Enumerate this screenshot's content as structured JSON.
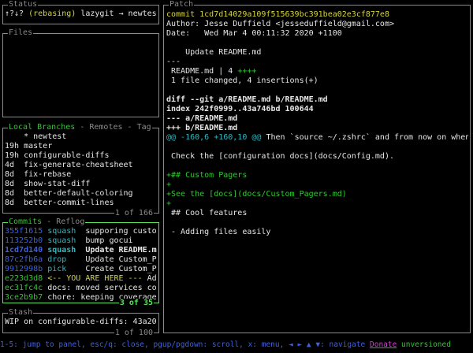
{
  "colors": {
    "blue": "#3f5fe0",
    "cyan": "#2fb8c0",
    "green": "#2ec82e",
    "yellow": "#d6d63a",
    "white": "#e6e6e6",
    "grey": "#8a8a8a",
    "magenta": "#d040d0",
    "frame_active": "#5fe35f"
  },
  "status": {
    "title": "Status",
    "line": [
      {
        "t": "↑?↓? ",
        "c": "white"
      },
      {
        "t": "(rebasing)",
        "c": "yellow"
      },
      {
        "t": " lazygit → newtes",
        "c": "white"
      }
    ]
  },
  "files": {
    "title": "Files"
  },
  "branches": {
    "tabs": [
      {
        "label": "Local Branches",
        "active": true
      },
      {
        "label": "Remotes",
        "active": false
      },
      {
        "label": "Tag",
        "active": false
      }
    ],
    "sep": " - ",
    "footer": "1 of 166",
    "items": [
      {
        "age": "",
        "name": "* newtest"
      },
      {
        "age": "19h",
        "name": "master"
      },
      {
        "age": "19h",
        "name": "configurable-diffs"
      },
      {
        "age": "4d",
        "name": "fix-generate-cheatsheet"
      },
      {
        "age": "8d",
        "name": "fix-rebase"
      },
      {
        "age": "8d",
        "name": "show-stat-diff"
      },
      {
        "age": "8d",
        "name": "better-default-coloring"
      },
      {
        "age": "8d",
        "name": "better-commit-lines"
      }
    ]
  },
  "commits": {
    "tabs": [
      {
        "label": "Commits",
        "active": true
      },
      {
        "label": "Reflog",
        "active": false
      }
    ],
    "sep": " - ",
    "footer": "3 of 35",
    "items": [
      {
        "hash": "355f1615",
        "hc": "blue",
        "action": "squash",
        "ac": "cyan",
        "msg": "supporing custo",
        "mc": "white",
        "selected": false
      },
      {
        "hash": "113252b0",
        "hc": "blue",
        "action": "squash",
        "ac": "cyan",
        "msg": "bump gocui",
        "mc": "white",
        "selected": false
      },
      {
        "hash": "1cd7d140",
        "hc": "blue",
        "action": "squash",
        "ac": "cyan",
        "msg": "Update README.m",
        "mc": "white",
        "selected": true
      },
      {
        "hash": "87c2fb6a",
        "hc": "blue",
        "action": "drop",
        "ac": "cyan",
        "msg": "Update Custom_P",
        "mc": "white",
        "selected": false
      },
      {
        "hash": "9912998b",
        "hc": "blue",
        "action": "pick",
        "ac": "cyan",
        "msg": "Create Custom_P",
        "mc": "white",
        "selected": false
      },
      {
        "hash": "e223d3d8",
        "hc": "green",
        "action": "<-- YOU ARE HERE ---",
        "ac": "yellow",
        "msg": "Ad",
        "mc": "white",
        "selected": false
      },
      {
        "hash": "ec31fc4c",
        "hc": "green",
        "action": "",
        "ac": "white",
        "msg": "docs: moved services co",
        "mc": "white",
        "selected": false
      },
      {
        "hash": "3ce2b9b7",
        "hc": "green",
        "action": "",
        "ac": "white",
        "msg": "chore: keeping coverage",
        "mc": "white",
        "selected": false
      }
    ]
  },
  "stash": {
    "title": "Stash",
    "footer": "1 of 100",
    "items": [
      "WIP on configurable-diffs: 43a20"
    ]
  },
  "patch": {
    "title": "Patch",
    "lines": [
      [
        {
          "t": "commit 1cd7d14029a109f515639bc391bea02e3cf877e8",
          "c": "yellow"
        }
      ],
      [
        {
          "t": "Author: Jesse Duffield <jesseduffield@gmail.com>",
          "c": "white"
        }
      ],
      [
        {
          "t": "Date:   Wed Mar 4 00:11:32 2020 +1100",
          "c": "white"
        }
      ],
      [],
      [
        {
          "t": "    Update README.md",
          "c": "white"
        }
      ],
      [
        {
          "t": "---",
          "c": "white"
        }
      ],
      [
        {
          "t": " README.md | 4 ",
          "c": "white"
        },
        {
          "t": "++++",
          "c": "green"
        }
      ],
      [
        {
          "t": " 1 file changed, 4 insertions(+)",
          "c": "white"
        }
      ],
      [],
      [
        {
          "t": "diff --git a/README.md b/README.md",
          "c": "white",
          "b": true
        }
      ],
      [
        {
          "t": "index 242f0999..43a746bd 100644",
          "c": "white",
          "b": true
        }
      ],
      [
        {
          "t": "--- a/README.md",
          "c": "white",
          "b": true
        }
      ],
      [
        {
          "t": "+++ b/README.md",
          "c": "white",
          "b": true
        }
      ],
      [
        {
          "t": "@@ -160,6 +160,10 @@",
          "c": "cyan"
        },
        {
          "t": " Then `source ~/.zshrc` and from now on when",
          "c": "white"
        }
      ],
      [],
      [
        {
          "t": " Check the [configuration docs](docs/Config.md).",
          "c": "white"
        }
      ],
      [],
      [
        {
          "t": "+## Custom Pagers",
          "c": "green"
        }
      ],
      [
        {
          "t": "+",
          "c": "green"
        }
      ],
      [
        {
          "t": "+See the [docs](docs/Custom_Pagers.md)",
          "c": "green"
        }
      ],
      [
        {
          "t": "+",
          "c": "green"
        }
      ],
      [
        {
          "t": " ## Cool features",
          "c": "white"
        }
      ],
      [],
      [
        {
          "t": " - Adding files easily",
          "c": "white"
        }
      ]
    ]
  },
  "statusbar": {
    "keys": "1-5: jump to panel, esc/q: close, pgup/pgdown: scroll, x: menu, ◄ ► ▲ ▼: navigate ",
    "donate": "Donate",
    "version": " unversioned"
  }
}
